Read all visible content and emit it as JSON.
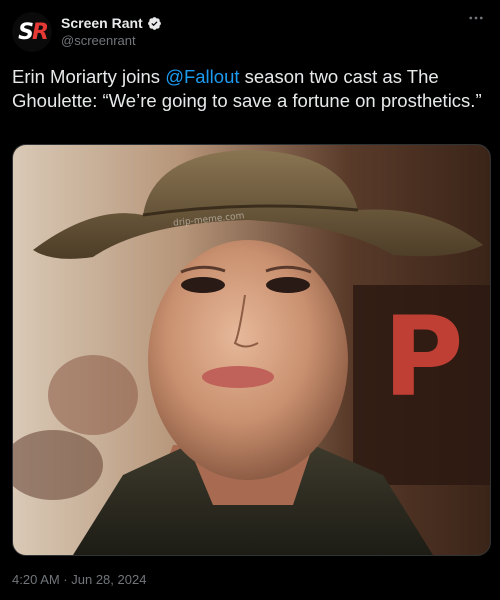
{
  "author": {
    "display_name": "Screen Rant",
    "handle": "@screenrant",
    "avatar_logo": {
      "letter_1": "S",
      "letter_2": "R"
    },
    "verified": true
  },
  "tweet": {
    "text_before": "Erin Moriarty joins ",
    "mention": "@Fallout",
    "text_after": " season two cast as The Ghoulette: “We’re going to save a fortune on prosthetics.”",
    "timestamp": "4:20 AM · Jun 28, 2024"
  },
  "media": {
    "watermark": "drip-meme.com",
    "sign_letter": "P"
  },
  "icons": {
    "more": "more-horizontal-icon",
    "verified": "verified-badge-icon"
  },
  "colors": {
    "background": "#000000",
    "text": "#e7e9ea",
    "secondary": "#71767b",
    "link": "#1d9bf0",
    "brand_red": "#e53935"
  }
}
